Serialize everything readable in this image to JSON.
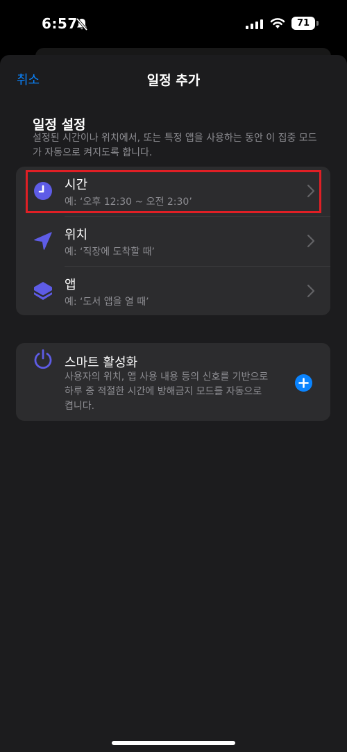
{
  "status_bar": {
    "time": "6:57",
    "battery": "71",
    "icons": [
      "bell-slash-icon",
      "cellular-signal-icon",
      "wifi-icon",
      "battery-icon"
    ]
  },
  "nav": {
    "cancel_label": "취소",
    "title": "일정 추가"
  },
  "section": {
    "title": "일정 설정",
    "description": "설정된 시간이나 위치에서, 또는 특정 앱을 사용하는 동안 이 집중 모드가 자동으로 켜지도록 합니다."
  },
  "options": [
    {
      "title": "시간",
      "subtitle": "예: ‘오후 12:30 ~ 오전 2:30’",
      "icon": "clock-icon",
      "highlighted": true
    },
    {
      "title": "위치",
      "subtitle": "예: ‘직장에 도착할 때’",
      "icon": "location-arrow-icon",
      "highlighted": false
    },
    {
      "title": "앱",
      "subtitle": "예: ‘도서 앱을 열 때’",
      "icon": "app-stack-icon",
      "highlighted": false
    }
  ],
  "smart": {
    "title": "스마트 활성화",
    "description": "사용자의 위치, 앱 사용 내용 등의 신호를 기반으로 하루 중 적절한 시간에 방해금지 모드를 자동으로 켭니다.",
    "icon": "power-icon",
    "add_icon": "plus-circle-icon"
  },
  "colors": {
    "accent": "#0a84ff",
    "icon_purple": "#5e5ce6",
    "highlight": "#e01f25",
    "sheet_bg": "#1c1c1e",
    "card_bg": "#2c2c2e"
  }
}
